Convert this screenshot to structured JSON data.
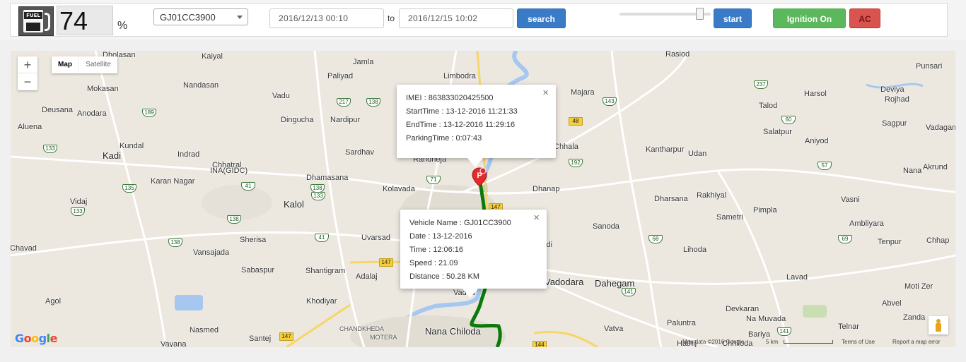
{
  "toolbar": {
    "fuel_icon_label": "FUEL",
    "fuel_value": "74",
    "fuel_unit": "%",
    "vehicle": "GJ01CC3900",
    "date_from": "2016/12/13 00:10",
    "to_label": "to",
    "date_to": "2016/12/15 10:02",
    "search_label": "search",
    "start_label": "start",
    "ignition_label": "Ignition On",
    "ac_label": "AC",
    "playback_speed_fraction": 0.88
  },
  "map": {
    "controls": {
      "zoom_in": "+",
      "zoom_out": "−",
      "map_tab": "Map",
      "satellite_tab": "Satellite"
    },
    "parking_popup": {
      "close": "×",
      "imei": "IMEI : 863833020425500",
      "start_time": "StartTime : 13-12-2016 11:21:33",
      "end_time": "EndTime : 13-12-2016 11:29:16",
      "parking_time": "ParkingTime : 0:07:43"
    },
    "vehicle_popup": {
      "close": "×",
      "vehicle_name": "Vehicle Name : GJ01CC3900",
      "date": "Date : 13-12-2016",
      "time": "Time : 12:06:16",
      "speed": "Speed : 21.09",
      "distance": "Distance : 50.28 KM"
    },
    "marker_letter": "P",
    "google": [
      "G",
      "o",
      "o",
      "g",
      "l",
      "e"
    ],
    "google_colors": [
      "#4285f4",
      "#ea4335",
      "#fbbc05",
      "#4285f4",
      "#34a853",
      "#ea4335"
    ],
    "footer": {
      "map_data": "Map data ©2016 Google",
      "scale": "5 km",
      "terms": "Terms of Use",
      "report": "Report a map error"
    },
    "route_color": "#0b7a0b",
    "places": [
      "Dholasan",
      "Kaiyal",
      "Jamla",
      "Rasiod",
      "Punsari",
      "Nandasan",
      "Paliyad",
      "Limbodra",
      "Mokasan",
      "Vadu",
      "Majara",
      "Harsol",
      "Deviya",
      "Rojhad",
      "Deusana",
      "Anodara",
      "Dingucha",
      "Nardipur",
      "Talod",
      "Sagpur",
      "Aluena",
      "Salatpur",
      "Vadagam",
      "Kundal",
      "Chhala",
      "Kadi",
      "Indrad",
      "Sardhav",
      "Kantharpur",
      "Udan",
      "Aniyod",
      "Chhatral",
      "INA(GIDC)",
      "Randheja",
      "Nana",
      "Akrund",
      "Karan Nagar",
      "Dhamasana",
      "Kolavada",
      "Dhanap",
      "Vidaj",
      "Kalol",
      "Rakhiyal",
      "Vasni",
      "Dharsana",
      "Pimpla",
      "Sametri",
      "Ambliyara",
      "Sanoda",
      "Tenpur",
      "Chhap",
      "Chavad",
      "Vansajada",
      "Sherisa",
      "Uvarsad",
      "Magodi",
      "Lihoda",
      "Sabaspur",
      "Shantigram",
      "Adalaj",
      "Vadodara",
      "Dahegam",
      "Lavad",
      "Moti Zer",
      "Agol",
      "Khodiyar",
      "Devkaran",
      "Abvel",
      "Na Muvada",
      "Zanda",
      "Nasmed",
      "Nana Chiloda",
      "Vatva",
      "Paluntra",
      "Bariya",
      "Telnar",
      "Vayana",
      "Santej",
      "Hathij",
      "Vadod",
      "Chhiloda"
    ],
    "small_places": [
      "CHANDKHEDA",
      "MOTERA"
    ],
    "shields": [
      "189",
      "217",
      "138",
      "237",
      "143",
      "133",
      "48",
      "60",
      "192",
      "57",
      "135",
      "41",
      "133",
      "71",
      "147",
      "138",
      "68",
      "69",
      "41",
      "147",
      "141",
      "147",
      "144",
      "141",
      "133",
      "138",
      "138"
    ]
  }
}
